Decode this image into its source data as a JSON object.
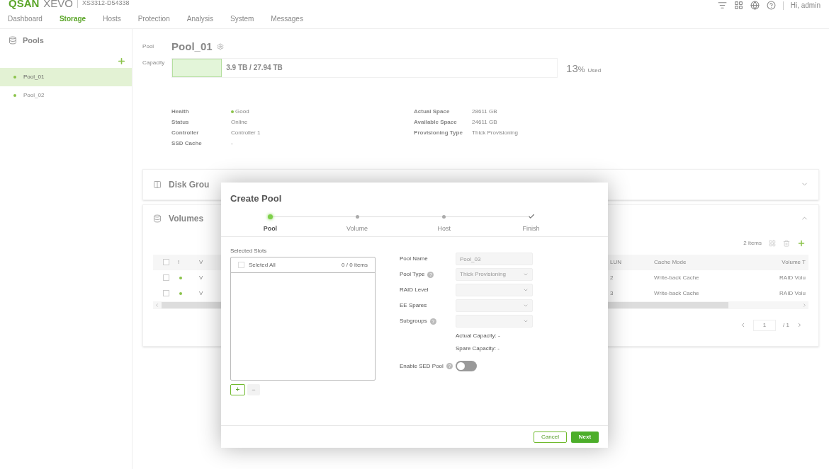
{
  "header": {
    "logo": "QSAN",
    "logo_product": "XEVO",
    "device": "XS3312-D54338",
    "greeting": "Hi, admin"
  },
  "nav": [
    {
      "label": "Dashboard",
      "selected": false
    },
    {
      "label": "Storage",
      "selected": true
    },
    {
      "label": "Hosts",
      "selected": false
    },
    {
      "label": "Protection",
      "selected": false
    },
    {
      "label": "Analysis",
      "selected": false
    },
    {
      "label": "System",
      "selected": false
    },
    {
      "label": "Messages",
      "selected": false
    }
  ],
  "sidebar": {
    "title": "Pools",
    "items": [
      {
        "label": "Pool_01",
        "selected": true,
        "color": "#8bc34a"
      },
      {
        "label": "Pool_02",
        "selected": false,
        "color": "#8bc34a"
      }
    ]
  },
  "pool": {
    "label": "Pool",
    "name": "Pool_01",
    "capacity_label": "Capacity",
    "capacity": {
      "level": 0.13,
      "text": "3.9 TB / 27.94 TB"
    },
    "used_value": "13",
    "used_unit": "%",
    "used_label": "Used",
    "info_left": [
      {
        "label": "Health",
        "value": "Good",
        "color": "#8bc34a"
      },
      {
        "label": "Status",
        "value": "Online"
      },
      {
        "label": "Controller",
        "value": "Controller 1"
      },
      {
        "label": "SSD Cache",
        "value": "-"
      }
    ],
    "info_right": [
      {
        "label": "Actual Space",
        "value": "28611 GB"
      },
      {
        "label": "Available Space",
        "value": "24611 GB"
      },
      {
        "label": "Provisioning Type",
        "value": "Thick Provisioning"
      }
    ]
  },
  "disk_group": {
    "title": "Disk Grou",
    "expanded": false
  },
  "volumes": {
    "title": "Volumes",
    "expanded": true,
    "count": "2 items",
    "all_checked": false,
    "columns": [
      "!",
      "V",
      "LUN",
      "Cache Mode",
      "Volume T"
    ],
    "rows": [
      {
        "checked": false,
        "color": "#8bc34a",
        "name": "V",
        "lun": "2",
        "cache": "Write-back Cache",
        "type": "RAID Volu"
      },
      {
        "checked": false,
        "color": "#8bc34a",
        "name": "V",
        "lun": "3",
        "cache": "Write-back Cache",
        "type": "RAID Volu"
      }
    ],
    "page": "1",
    "pages": "/ 1"
  },
  "dialog": {
    "title": "Create Pool",
    "steps": [
      {
        "label": "Pool",
        "selected": true,
        "kind": "step"
      },
      {
        "label": "Volume",
        "selected": false,
        "kind": "step"
      },
      {
        "label": "Host",
        "selected": false,
        "kind": "step"
      },
      {
        "label": "Finish",
        "selected": false,
        "kind": "final"
      }
    ],
    "slots_label": "Selected Slots",
    "select_all": {
      "label": "Seleted All",
      "checked": false
    },
    "slots_count": "0 / 0 items",
    "add_button": "+",
    "remove_button": "−",
    "remove_disabled": true,
    "fields": [
      {
        "label": "Pool Name",
        "kind": "text",
        "value": "Pool_03",
        "help": false,
        "disabled": true
      },
      {
        "label": "Pool Type",
        "kind": "select",
        "value": "Thick Provisioning",
        "help": true,
        "disabled": true
      },
      {
        "label": "RAID Level",
        "kind": "select",
        "help": false,
        "disabled": true
      },
      {
        "label": "EE Spares",
        "kind": "select",
        "help": false,
        "disabled": true
      },
      {
        "label": "Subgroups",
        "kind": "select",
        "help": true,
        "disabled": true
      }
    ],
    "actual_capacity": "Actual Capacity: -",
    "spare_capacity": "Spare Capacity: -",
    "sed": {
      "label": "Enable SED Pool",
      "help": true,
      "on": false
    },
    "help_mark": "?",
    "cancel": "Cancel",
    "next": "Next"
  }
}
